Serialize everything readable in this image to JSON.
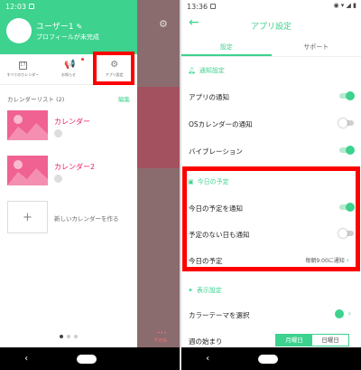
{
  "left": {
    "status_time": "12:03",
    "user": {
      "name": "ユーザー1",
      "subtitle": "プロフィールが未完成"
    },
    "menu": [
      {
        "label": "すべてのカレンダー",
        "icon": "calendar-icon",
        "cal_num": "17"
      },
      {
        "label": "お知らせ",
        "icon": "megaphone-icon"
      },
      {
        "label": "アプリ設定",
        "icon": "gear-icon"
      }
    ],
    "calendar_list_header": "カレンダーリスト (2)",
    "edit_label": "編集",
    "calendars": [
      {
        "name": "カレンダー"
      },
      {
        "name": "カレンダー2"
      }
    ],
    "add_label": "新しいカレンダーを作る",
    "overlay_label": "予定帳",
    "overlay_dots": "•••",
    "nav": {
      "back": "‹"
    }
  },
  "right": {
    "status_time": "13:36",
    "title": "アプリ設定",
    "back_icon": "←",
    "tabs": [
      "設定",
      "サポート"
    ],
    "sections": {
      "notify": "通知設定",
      "today": "今日の予定",
      "display": "表示設定"
    },
    "rows": {
      "app_notify": "アプリの通知",
      "os_notify": "OSカレンダーの通知",
      "vibration": "バイブレーション",
      "today_notify": "今日の予定を通知",
      "no_event_notify": "予定のない日も通知",
      "today_event": "今日の予定",
      "today_event_value": "毎朝9:00に通知",
      "theme": "カラーテーマを選択",
      "week_start": "週の始まり"
    },
    "toggles": {
      "app_notify": true,
      "os_notify": false,
      "vibration": true,
      "today_notify": true,
      "no_event_notify": false
    },
    "week_start_options": [
      "月曜日",
      "日曜日"
    ],
    "week_start_selected": "月曜日"
  },
  "colors": {
    "accent": "#3dd28e",
    "highlight": "#ff0000",
    "pink": "#f06292"
  }
}
